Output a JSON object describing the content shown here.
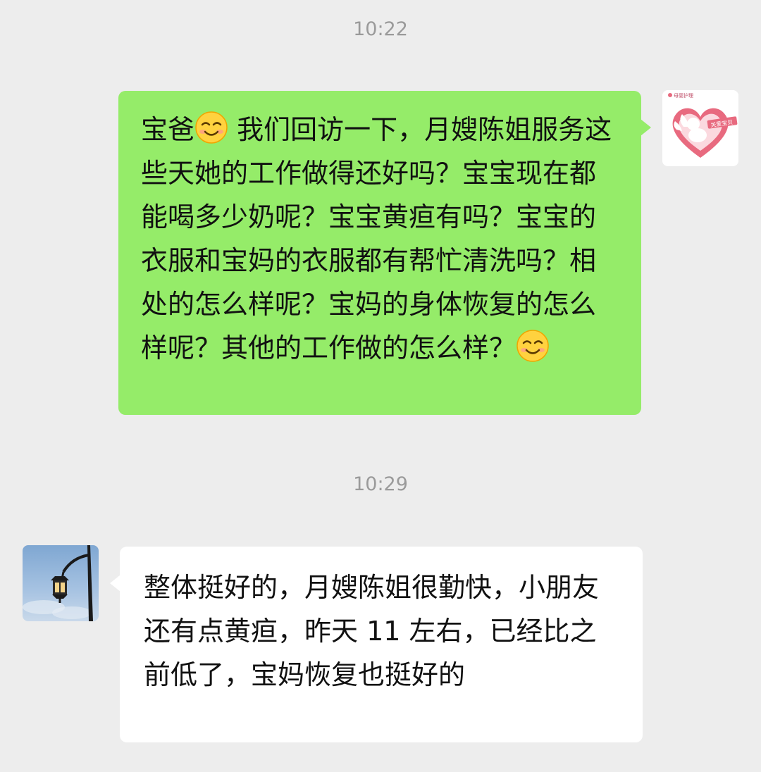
{
  "messages": [
    {
      "timestamp": "10:22",
      "sender": "me",
      "parts": [
        "宝爸",
        " 我们回访一下，月嫂陈姐服务这些天她的工作做得还好吗？宝宝现在都能喝多少奶呢？宝宝黄疸有吗？宝宝的衣服和宝妈的衣服都有帮忙清洗吗？相处的怎么样呢？宝妈的身体恢复的怎么样呢？其他的工作做的怎么样？",
        " "
      ],
      "emoji": "smiling-face-with-smiling-eyes",
      "bubble_color": "#95ec69"
    },
    {
      "timestamp": "10:29",
      "sender": "other",
      "text": "整体挺好的，月嫂陈姐很勤快，小朋友还有点黄疸，昨天 11 左右，已经比之前低了，宝妈恢复也挺好的",
      "bubble_color": "#ffffff"
    }
  ],
  "me_avatar": {
    "icon": "cupid-heart-logo-icon",
    "logo_small_text": "母婴护理",
    "logo_banner_text": "关爱宝贝",
    "accent": "#e86a7f"
  },
  "other_avatar": {
    "icon": "street-lamp-sky-icon"
  },
  "colors": {
    "background": "#ededed",
    "timestamp": "#9a9a9a",
    "outgoing_bubble": "#95ec69",
    "incoming_bubble": "#ffffff"
  }
}
